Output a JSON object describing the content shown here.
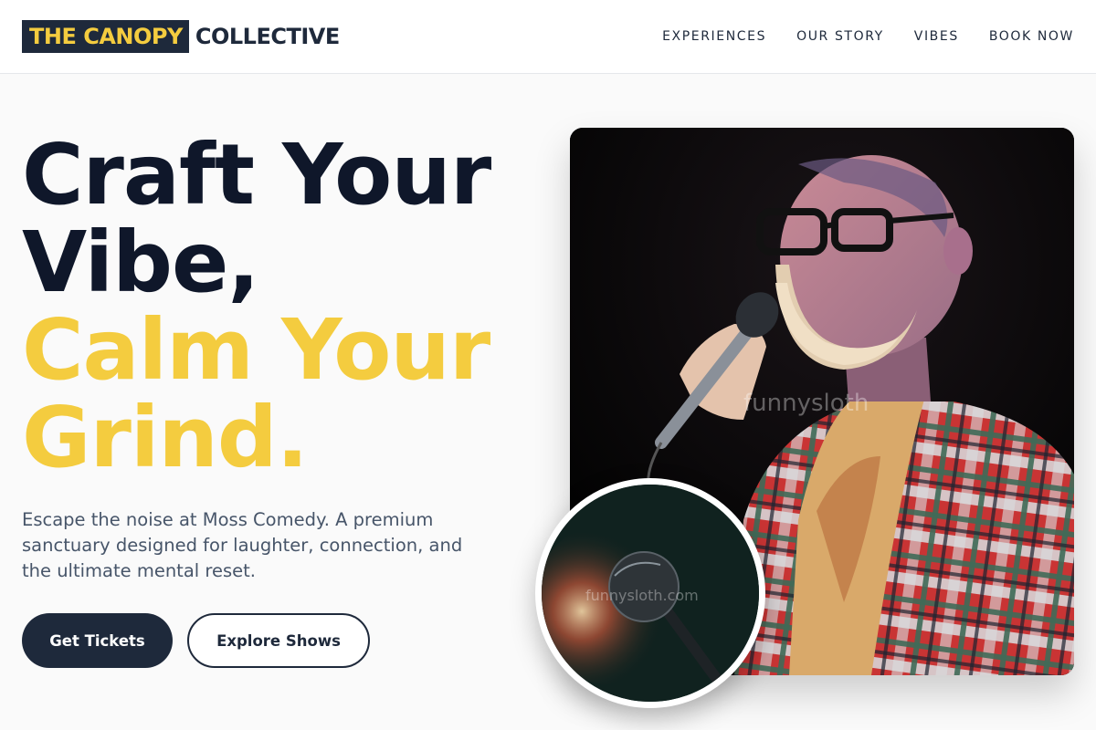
{
  "brand": {
    "highlight": "THE CANOPY",
    "rest": "COLLECTIVE",
    "highlight_bg": "#1e293b",
    "highlight_color": "#f4cc3f"
  },
  "nav": [
    {
      "label": "EXPERIENCES"
    },
    {
      "label": "OUR STORY"
    },
    {
      "label": "VIBES"
    },
    {
      "label": "BOOK NOW"
    }
  ],
  "hero": {
    "title_line1": "Craft Your",
    "title_line2": "Vibe,",
    "title_line3": "Calm Your",
    "title_line4": "Grind.",
    "description": "Escape the noise at Moss Comedy. A premium sanctuary designed for laughter, connection, and the ultimate mental reset.",
    "primary_button": "Get Tickets",
    "secondary_button": "Explore Shows"
  },
  "images": {
    "main": {
      "subject": "bearded comedian with glasses holding microphone, red plaid shirt",
      "watermark": "funnysloth"
    },
    "inset": {
      "subject": "microphone close-up on dark teal background",
      "watermark": "funnysloth.com"
    }
  },
  "colors": {
    "dark": "#0f172a",
    "gold": "#f4cc3f",
    "button_dark": "#1e293b",
    "page_bg": "#fafafa"
  }
}
